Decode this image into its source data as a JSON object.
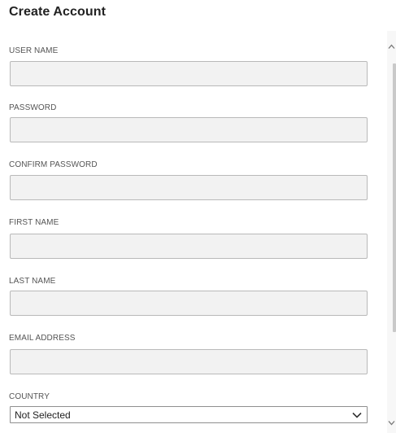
{
  "page": {
    "title": "Create Account"
  },
  "form": {
    "username": {
      "label": "USER NAME",
      "value": "",
      "placeholder": ""
    },
    "password": {
      "label": "PASSWORD",
      "value": "",
      "placeholder": ""
    },
    "confirm_password": {
      "label": "CONFIRM PASSWORD",
      "value": "",
      "placeholder": ""
    },
    "first_name": {
      "label": "FIRST NAME",
      "value": "",
      "placeholder": ""
    },
    "last_name": {
      "label": "LAST NAME",
      "value": "",
      "placeholder": ""
    },
    "email": {
      "label": "EMAIL ADDRESS",
      "value": "",
      "placeholder": ""
    },
    "country": {
      "label": "COUNTRY",
      "selected": "Not Selected",
      "icon": "chevron-down-icon"
    }
  },
  "scrollbar": {
    "up_icon": "chevron-up-icon",
    "down_icon": "chevron-down-icon"
  },
  "colors": {
    "input_background": "#f2f2f2",
    "input_border": "#b9b9b9",
    "label_text": "#555555",
    "title_text": "#222222"
  }
}
